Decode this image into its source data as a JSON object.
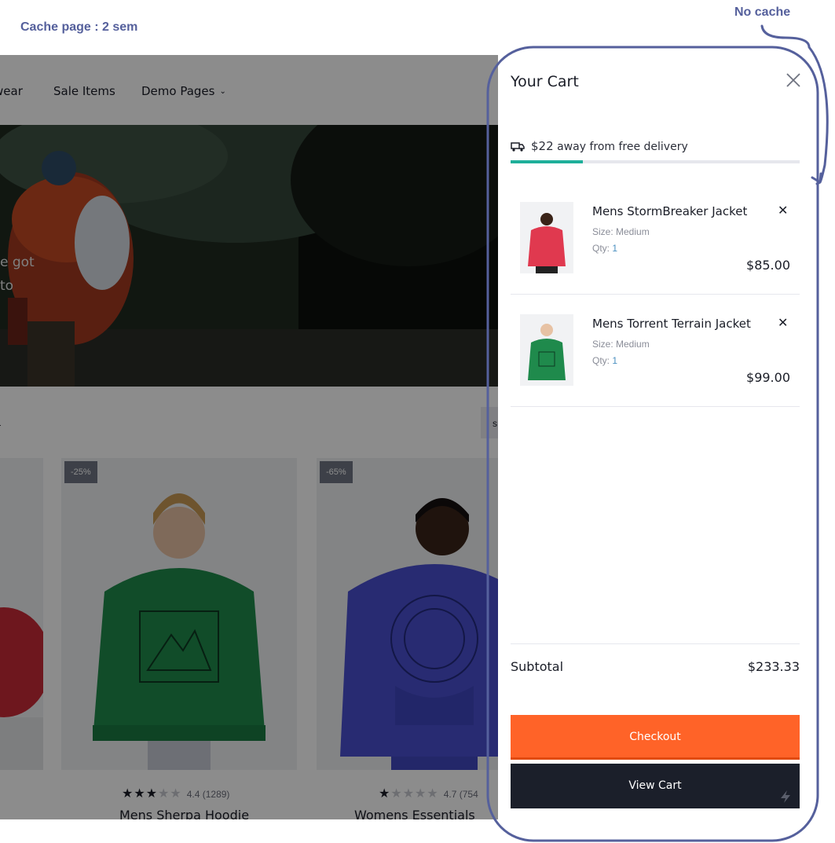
{
  "annotations": {
    "left": "Cache page : 2 sem",
    "right": "No cache"
  },
  "nav": {
    "items": [
      "wear",
      "Sale Items",
      "Demo Pages"
    ]
  },
  "hero": {
    "line1": "e got",
    "line2": "to"
  },
  "filter": {
    "link": "l",
    "sort": "s"
  },
  "products": [
    {
      "badge": "",
      "rating": "",
      "name": ""
    },
    {
      "badge": "-25%",
      "rating": "4.4 (1289)",
      "stars": 3,
      "name": "Mens Sherpa Hoodie",
      "color": "#1f8a4c"
    },
    {
      "badge": "-65%",
      "rating": "4.7 (754",
      "stars": 1,
      "name": "Womens Essentials Hoo",
      "color": "#4a4fd0"
    }
  ],
  "cart": {
    "title": "Your Cart",
    "delivery": {
      "amount": "$22",
      "text": "away from free delivery",
      "progress": 0.25
    },
    "items": [
      {
        "name": "Mens StormBreaker Jacket",
        "size": "Size: Medium",
        "qty_label": "Qty:",
        "qty": "1",
        "price": "$85.00",
        "color": "#e0394f"
      },
      {
        "name": "Mens Torrent Terrain Jacket",
        "size": "Size: Medium",
        "qty_label": "Qty:",
        "qty": "1",
        "price": "$99.00",
        "color": "#1f8a4c"
      }
    ],
    "subtotal_label": "Subtotal",
    "subtotal_value": "$233.33",
    "checkout_label": "Checkout",
    "view_cart_label": "View Cart"
  },
  "colors": {
    "annotation": "#55609c",
    "checkout": "#ff6328",
    "view_cart": "#1b1f2a",
    "progress": "#1eaf9a"
  }
}
